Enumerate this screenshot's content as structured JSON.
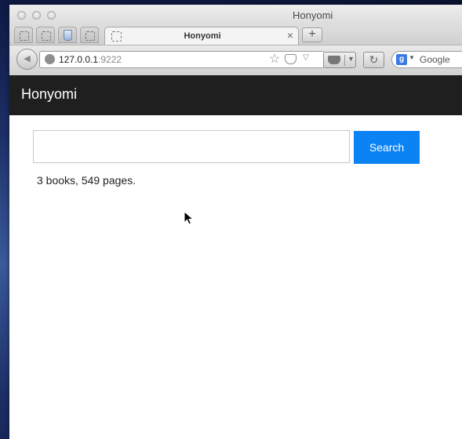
{
  "browser": {
    "window_title": "Honyomi",
    "active_tab_title": "Honyomi",
    "url_host": "127.0.0.1",
    "url_port": ":9222",
    "search_engine_placeholder": "Google",
    "new_tab_symbol": "+",
    "close_tab_symbol": "×",
    "reload_symbol": "↻",
    "back_symbol": "◀",
    "star_symbol": "☆",
    "dropdown_symbol": "▽"
  },
  "app": {
    "title": "Honyomi",
    "search_placeholder": "",
    "search_value": "",
    "search_button_label": "Search",
    "summary": "3 books, 549 pages."
  },
  "colors": {
    "header_bg": "#1f1f1f",
    "accent": "#0b83f5"
  }
}
